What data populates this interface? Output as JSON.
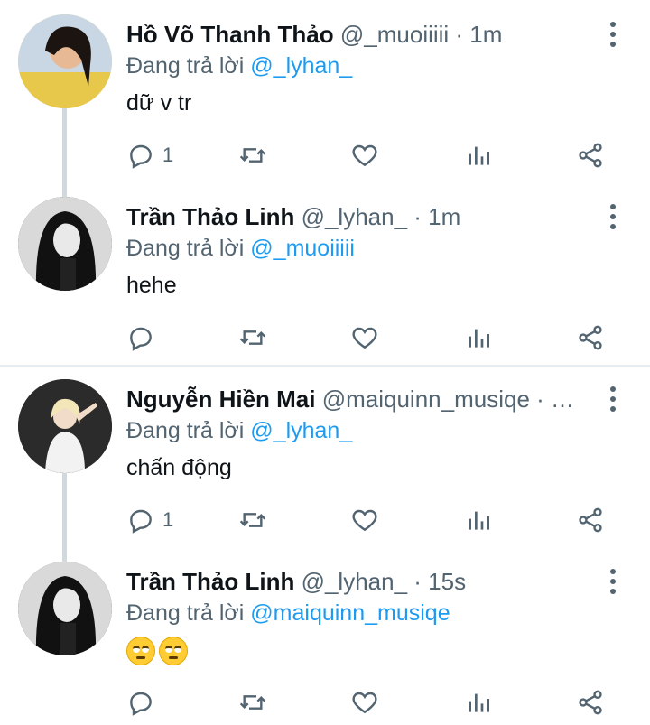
{
  "tweets": [
    {
      "name": "Hồ Võ Thanh Thảo",
      "handle": "@_muoiiiii · 1m",
      "reply_prefix": "Đang trả lời ",
      "reply_to": "@_lyhan_",
      "text": "dữ v tr",
      "reply_count": "1",
      "avatar_bg": "#e9d27a"
    },
    {
      "name": "Trần Thảo Linh",
      "handle": "@_lyhan_ · 1m",
      "reply_prefix": "Đang trả lời ",
      "reply_to": "@_muoiiiii",
      "text": "hehe",
      "reply_count": "",
      "avatar_bg": "#2a2a2a"
    },
    {
      "name": "Nguyễn Hiền Mai",
      "handle": "@maiquinn_musiqe · …",
      "reply_prefix": "Đang trả lời ",
      "reply_to": "@_lyhan_",
      "text": "chấn động",
      "reply_count": "1",
      "avatar_bg": "#3a3a3a"
    },
    {
      "name": "Trần Thảo Linh",
      "handle": "@_lyhan_ · 15s",
      "reply_prefix": "Đang trả lời ",
      "reply_to": "@maiquinn_musiqe",
      "text": "",
      "reply_count": "",
      "avatar_bg": "#2a2a2a"
    }
  ],
  "colors": {
    "accent": "#1d9bf0",
    "secondary_text": "#536471",
    "thread_line": "#cfd9de"
  },
  "icons": [
    "reply-icon",
    "retweet-icon",
    "like-icon",
    "analytics-icon",
    "share-icon",
    "more-icon"
  ]
}
